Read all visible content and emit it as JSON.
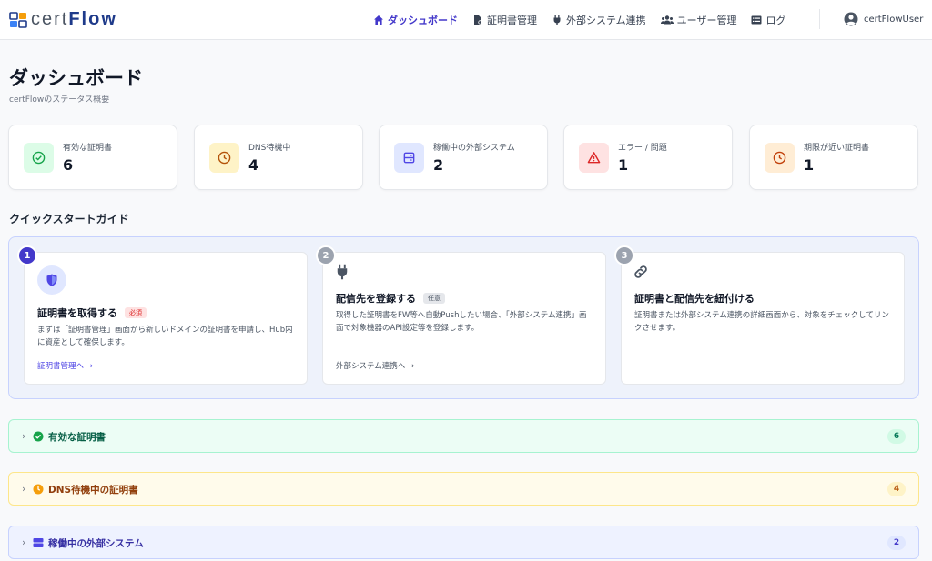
{
  "header": {
    "logo_prefix": "cert",
    "logo_suffix": "Flow",
    "nav": [
      {
        "label": "ダッシュボード",
        "icon": "home-icon",
        "active": true
      },
      {
        "label": "証明書管理",
        "icon": "certificate-icon",
        "active": false
      },
      {
        "label": "外部システム連携",
        "icon": "plug-icon",
        "active": false
      },
      {
        "label": "ユーザー管理",
        "icon": "users-icon",
        "active": false
      },
      {
        "label": "ログ",
        "icon": "list-icon",
        "active": false
      }
    ],
    "user": "certFlowUser"
  },
  "page": {
    "title": "ダッシュボード",
    "subtitle": "certFlowのステータス概要"
  },
  "stats": [
    {
      "label": "有効な証明書",
      "value": "6",
      "icon": "check-circle-icon",
      "bg": "#dcfce7",
      "color": "#16a34a"
    },
    {
      "label": "DNS待機中",
      "value": "4",
      "icon": "clock-icon",
      "bg": "#fef3c7",
      "color": "#b45309"
    },
    {
      "label": "稼働中の外部システム",
      "value": "2",
      "icon": "server-icon",
      "bg": "#e0e7ff",
      "color": "#4f46e5"
    },
    {
      "label": "エラー / 問題",
      "value": "1",
      "icon": "warning-icon",
      "bg": "#fee2e2",
      "color": "#dc2626"
    },
    {
      "label": "期限が近い証明書",
      "value": "1",
      "icon": "clock-icon",
      "bg": "#ffedd5",
      "color": "#c2410c"
    }
  ],
  "quickstart": {
    "title": "クイックスタートガイド",
    "steps": [
      {
        "num": "1",
        "title": "証明書を取得する",
        "badge": "必須",
        "desc": "まずは「証明書管理」画面から新しいドメインの証明書を申請し、Hub内に資産として確保します。",
        "link": "証明書管理へ →"
      },
      {
        "num": "2",
        "title": "配信先を登録する",
        "badge": "任意",
        "desc": "取得した証明書をFW等へ自動Pushしたい場合、「外部システム連携」画面で対象機器のAPI設定等を登録します。",
        "link": "外部システム連携へ →"
      },
      {
        "num": "3",
        "title": "証明書と配信先を紐付ける",
        "badge": "",
        "desc": "証明書または外部システム連携の詳細画面から、対象をチェックしてリンクさせます。",
        "link": ""
      }
    ]
  },
  "accordions": [
    {
      "label": "有効な証明書",
      "count": "6",
      "icon": "check-circle-icon"
    },
    {
      "label": "DNS待機中の証明書",
      "count": "4",
      "icon": "clock-icon"
    },
    {
      "label": "稼働中の外部システム",
      "count": "2",
      "icon": "server-icon"
    }
  ],
  "colors": {
    "accent": "#4338ca",
    "link": "#4f46e5",
    "green": "#16a34a",
    "amber": "#d97706",
    "indigo": "#4f46e5"
  }
}
